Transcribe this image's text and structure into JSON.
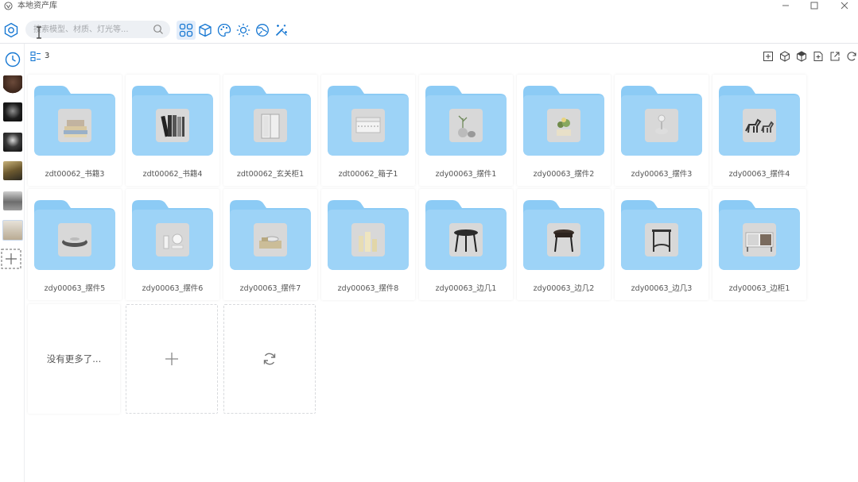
{
  "window": {
    "title": "本地资产库"
  },
  "search": {
    "placeholder": "搜索模型、材质、灯光等..."
  },
  "filters": [
    {
      "icon": "grid-all-icon",
      "active": true
    },
    {
      "icon": "cube-model-icon",
      "active": false
    },
    {
      "icon": "palette-material-icon",
      "active": false
    },
    {
      "icon": "sun-light-icon",
      "active": false
    },
    {
      "icon": "globe-environment-icon",
      "active": false
    },
    {
      "icon": "magic-wand-icon",
      "active": false
    }
  ],
  "rail": [
    {
      "icon": "clock-icon"
    },
    {
      "icon": "brown-material-thumb"
    },
    {
      "icon": "dark-hdri-thumb"
    },
    {
      "icon": "spotlight-thumb"
    },
    {
      "icon": "gold-scene-thumb"
    },
    {
      "icon": "gray-model-thumb"
    },
    {
      "icon": "beige-model-thumb"
    },
    {
      "icon": "add-category-icon"
    }
  ],
  "header": {
    "count": "3"
  },
  "actions": [
    "add-file-icon",
    "cube-outline-icon",
    "cube-solid-icon",
    "import-icon",
    "export-icon",
    "refresh-icon"
  ],
  "items": [
    {
      "label": "zdt00062_书籍3",
      "thumb": "books-stack"
    },
    {
      "label": "zdt00062_书籍4",
      "thumb": "books-upright"
    },
    {
      "label": "zdt00062_玄关柜1",
      "thumb": "cabinet"
    },
    {
      "label": "zdt00062_箱子1",
      "thumb": "box"
    },
    {
      "label": "zdy00063_摆件1",
      "thumb": "vases"
    },
    {
      "label": "zdy00063_摆件2",
      "thumb": "plant"
    },
    {
      "label": "zdy00063_摆件3",
      "thumb": "flower"
    },
    {
      "label": "zdy00063_摆件4",
      "thumb": "horses"
    },
    {
      "label": "zdy00063_摆件5",
      "thumb": "bowl"
    },
    {
      "label": "zdy00063_摆件6",
      "thumb": "glassware"
    },
    {
      "label": "zdy00063_摆件7",
      "thumb": "tray"
    },
    {
      "label": "zdy00063_摆件8",
      "thumb": "candles"
    },
    {
      "label": "zdy00063_边几1",
      "thumb": "side-table-round"
    },
    {
      "label": "zdy00063_边几2",
      "thumb": "side-table-dark"
    },
    {
      "label": "zdy00063_边几3",
      "thumb": "side-table-square"
    },
    {
      "label": "zdy00063_边柜1",
      "thumb": "side-cabinet"
    }
  ],
  "footer": {
    "no_more": "没有更多了..."
  },
  "colors": {
    "accent": "#1677d2",
    "folder": "#9dd3f7",
    "folder_tab": "#8ccbf5"
  }
}
